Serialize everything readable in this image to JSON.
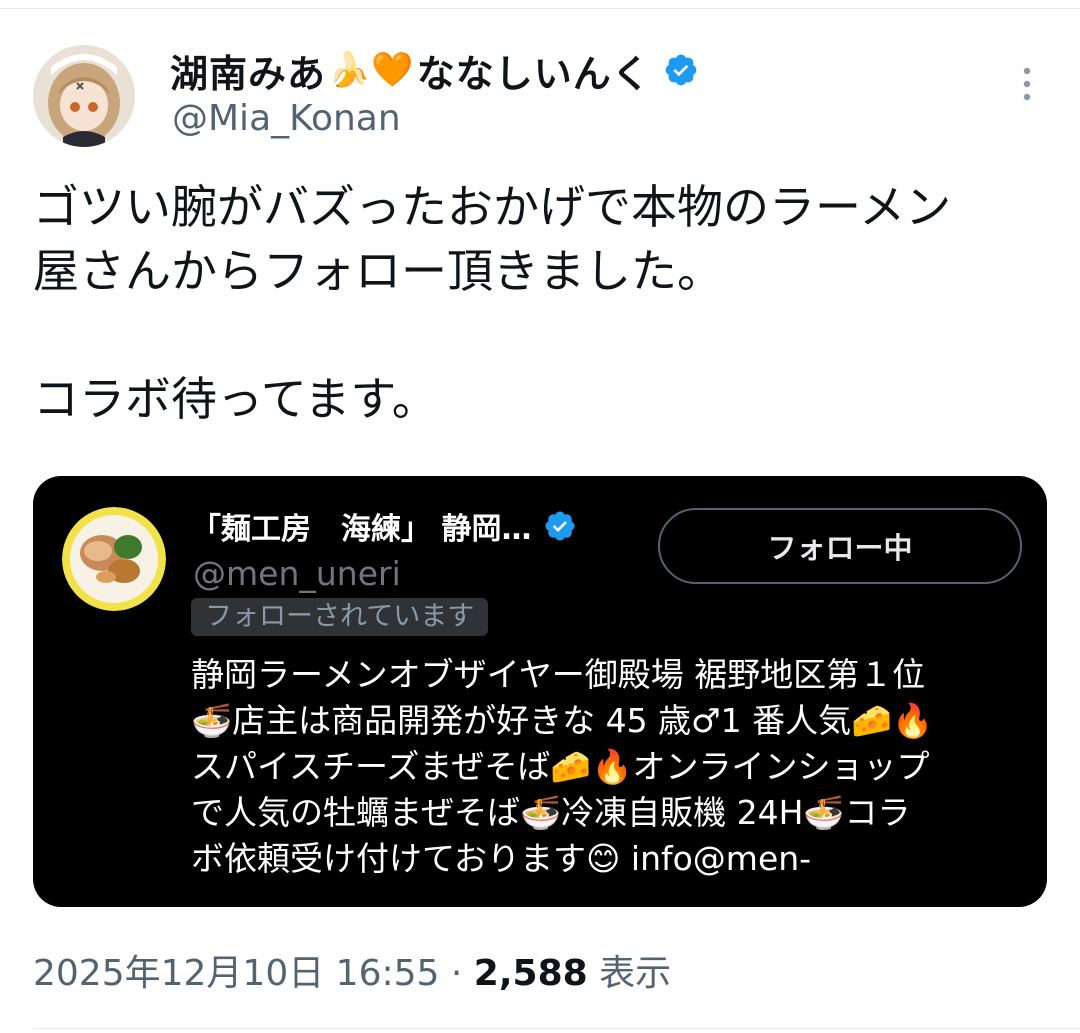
{
  "author": {
    "name_part1": "湖南みあ",
    "name_emoji": "🍌🧡",
    "name_part2": "ななしいんく",
    "handle": "@Mia_Konan"
  },
  "tweet": {
    "lines": [
      "ゴツい腕がバズったおかげで本物のラーメン",
      "屋さんからフォロー頂きました。",
      "",
      "コラボ待ってます。"
    ]
  },
  "embedded_profile": {
    "name": "「麺工房　海練」 静岡…",
    "handle": "@men_uneri",
    "followed_badge": "フォローされています",
    "follow_button": "フォロー中",
    "bio_lines": [
      "静岡ラーメンオブザイヤー御殿場 裾野地区第１位",
      "🍜店主は商品開発が好きな 45 歳♂1 番人気🧀🔥",
      "スパイスチーズまぜそば🧀🔥オンラインショップ",
      "で人気の牡蠣まぜそば🍜冷凍自販機 24H🍜コラ",
      "ボ依頼受け付けております😊 info@men-"
    ]
  },
  "meta": {
    "timestamp": "2025年12月10日 16:55",
    "separator": "·",
    "views": "2,588",
    "views_label": "表示"
  },
  "colors": {
    "verified_blue": "#1d9bf0",
    "text_primary": "#0f1419",
    "text_secondary": "#536471",
    "card_bg": "#000000"
  },
  "icons": [
    "verified-badge-icon",
    "more-options-icon"
  ]
}
